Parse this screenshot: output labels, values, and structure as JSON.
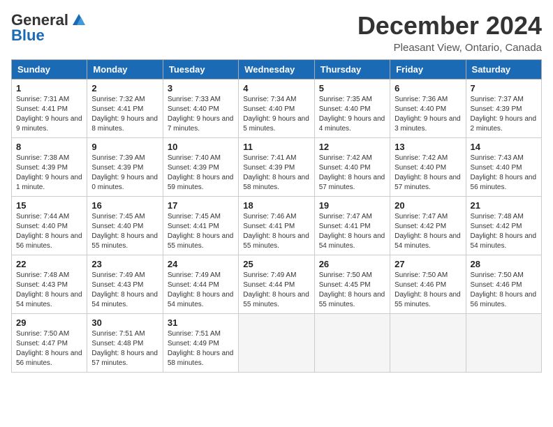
{
  "logo": {
    "line1": "General",
    "line2": "Blue"
  },
  "title": "December 2024",
  "location": "Pleasant View, Ontario, Canada",
  "days_of_week": [
    "Sunday",
    "Monday",
    "Tuesday",
    "Wednesday",
    "Thursday",
    "Friday",
    "Saturday"
  ],
  "weeks": [
    [
      {
        "day": "1",
        "sunrise": "7:31 AM",
        "sunset": "4:41 PM",
        "daylight": "9 hours and 9 minutes."
      },
      {
        "day": "2",
        "sunrise": "7:32 AM",
        "sunset": "4:41 PM",
        "daylight": "9 hours and 8 minutes."
      },
      {
        "day": "3",
        "sunrise": "7:33 AM",
        "sunset": "4:40 PM",
        "daylight": "9 hours and 7 minutes."
      },
      {
        "day": "4",
        "sunrise": "7:34 AM",
        "sunset": "4:40 PM",
        "daylight": "9 hours and 5 minutes."
      },
      {
        "day": "5",
        "sunrise": "7:35 AM",
        "sunset": "4:40 PM",
        "daylight": "9 hours and 4 minutes."
      },
      {
        "day": "6",
        "sunrise": "7:36 AM",
        "sunset": "4:40 PM",
        "daylight": "9 hours and 3 minutes."
      },
      {
        "day": "7",
        "sunrise": "7:37 AM",
        "sunset": "4:39 PM",
        "daylight": "9 hours and 2 minutes."
      }
    ],
    [
      {
        "day": "8",
        "sunrise": "7:38 AM",
        "sunset": "4:39 PM",
        "daylight": "9 hours and 1 minute."
      },
      {
        "day": "9",
        "sunrise": "7:39 AM",
        "sunset": "4:39 PM",
        "daylight": "9 hours and 0 minutes."
      },
      {
        "day": "10",
        "sunrise": "7:40 AM",
        "sunset": "4:39 PM",
        "daylight": "8 hours and 59 minutes."
      },
      {
        "day": "11",
        "sunrise": "7:41 AM",
        "sunset": "4:39 PM",
        "daylight": "8 hours and 58 minutes."
      },
      {
        "day": "12",
        "sunrise": "7:42 AM",
        "sunset": "4:40 PM",
        "daylight": "8 hours and 57 minutes."
      },
      {
        "day": "13",
        "sunrise": "7:42 AM",
        "sunset": "4:40 PM",
        "daylight": "8 hours and 57 minutes."
      },
      {
        "day": "14",
        "sunrise": "7:43 AM",
        "sunset": "4:40 PM",
        "daylight": "8 hours and 56 minutes."
      }
    ],
    [
      {
        "day": "15",
        "sunrise": "7:44 AM",
        "sunset": "4:40 PM",
        "daylight": "8 hours and 56 minutes."
      },
      {
        "day": "16",
        "sunrise": "7:45 AM",
        "sunset": "4:40 PM",
        "daylight": "8 hours and 55 minutes."
      },
      {
        "day": "17",
        "sunrise": "7:45 AM",
        "sunset": "4:41 PM",
        "daylight": "8 hours and 55 minutes."
      },
      {
        "day": "18",
        "sunrise": "7:46 AM",
        "sunset": "4:41 PM",
        "daylight": "8 hours and 55 minutes."
      },
      {
        "day": "19",
        "sunrise": "7:47 AM",
        "sunset": "4:41 PM",
        "daylight": "8 hours and 54 minutes."
      },
      {
        "day": "20",
        "sunrise": "7:47 AM",
        "sunset": "4:42 PM",
        "daylight": "8 hours and 54 minutes."
      },
      {
        "day": "21",
        "sunrise": "7:48 AM",
        "sunset": "4:42 PM",
        "daylight": "8 hours and 54 minutes."
      }
    ],
    [
      {
        "day": "22",
        "sunrise": "7:48 AM",
        "sunset": "4:43 PM",
        "daylight": "8 hours and 54 minutes."
      },
      {
        "day": "23",
        "sunrise": "7:49 AM",
        "sunset": "4:43 PM",
        "daylight": "8 hours and 54 minutes."
      },
      {
        "day": "24",
        "sunrise": "7:49 AM",
        "sunset": "4:44 PM",
        "daylight": "8 hours and 54 minutes."
      },
      {
        "day": "25",
        "sunrise": "7:49 AM",
        "sunset": "4:44 PM",
        "daylight": "8 hours and 55 minutes."
      },
      {
        "day": "26",
        "sunrise": "7:50 AM",
        "sunset": "4:45 PM",
        "daylight": "8 hours and 55 minutes."
      },
      {
        "day": "27",
        "sunrise": "7:50 AM",
        "sunset": "4:46 PM",
        "daylight": "8 hours and 55 minutes."
      },
      {
        "day": "28",
        "sunrise": "7:50 AM",
        "sunset": "4:46 PM",
        "daylight": "8 hours and 56 minutes."
      }
    ],
    [
      {
        "day": "29",
        "sunrise": "7:50 AM",
        "sunset": "4:47 PM",
        "daylight": "8 hours and 56 minutes."
      },
      {
        "day": "30",
        "sunrise": "7:51 AM",
        "sunset": "4:48 PM",
        "daylight": "8 hours and 57 minutes."
      },
      {
        "day": "31",
        "sunrise": "7:51 AM",
        "sunset": "4:49 PM",
        "daylight": "8 hours and 58 minutes."
      },
      null,
      null,
      null,
      null
    ]
  ]
}
